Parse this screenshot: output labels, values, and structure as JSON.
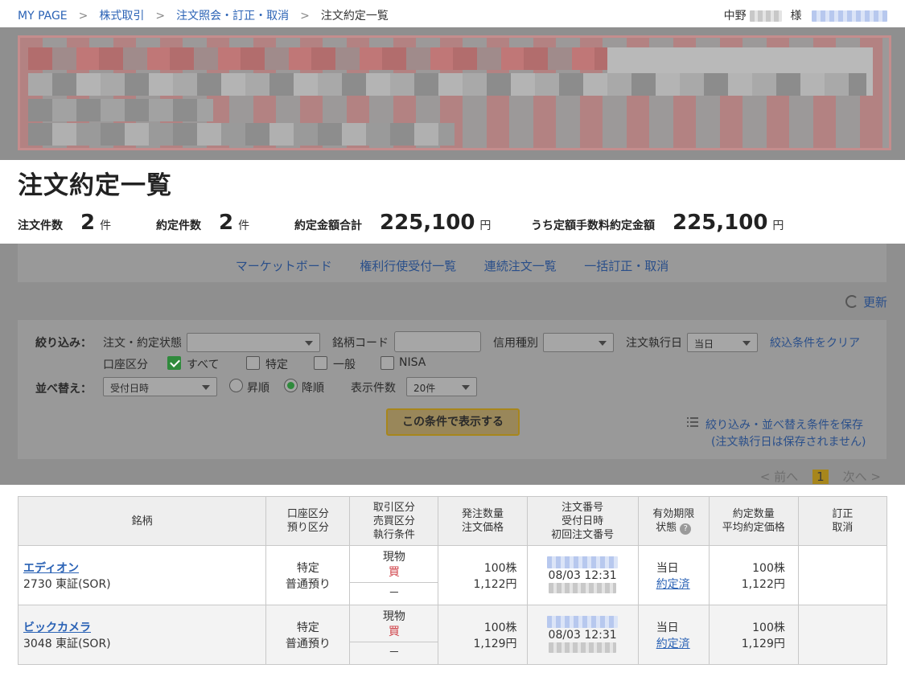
{
  "breadcrumb": {
    "items": [
      "MY PAGE",
      "株式取引",
      "注文照会・訂正・取消"
    ],
    "separator": ">",
    "current": "注文約定一覧"
  },
  "user": {
    "surname": "中野",
    "honorific": "様"
  },
  "page_title": "注文約定一覧",
  "summary": {
    "order_count_label": "注文件数",
    "order_count": "2",
    "order_count_unit": "件",
    "exec_count_label": "約定件数",
    "exec_count": "2",
    "exec_count_unit": "件",
    "exec_total_label": "約定金額合計",
    "exec_total": "225,100",
    "exec_total_unit": "円",
    "flat_fee_total_label": "うち定額手数料約定金額",
    "flat_fee_total": "225,100",
    "flat_fee_total_unit": "円"
  },
  "tabs": [
    "マーケットボード",
    "権利行使受付一覧",
    "連続注文一覧",
    "一括訂正・取消"
  ],
  "refresh_label": "更新",
  "filter": {
    "narrow_label": "絞り込み：",
    "status_label": "注文・約定状態",
    "code_label": "銘柄コード",
    "credit_label": "信用種別",
    "exec_date_label": "注文執行日",
    "exec_date_value": "当日",
    "clear_label": "絞込条件をクリア",
    "account_label": "口座区分",
    "account_options": [
      "すべて",
      "特定",
      "一般",
      "NISA"
    ],
    "account_checked": "すべて",
    "sort_label": "並べ替え：",
    "sort_value": "受付日時",
    "asc_label": "昇順",
    "desc_label": "降順",
    "sort_selected": "降順",
    "count_label": "表示件数",
    "count_value": "20件",
    "show_button": "この条件で表示する",
    "save_label": "絞り込み・並べ替え条件を保存",
    "save_note": "(注文執行日は保存されません)"
  },
  "pager": {
    "prev": "< 前へ",
    "current": "1",
    "next": "次へ >"
  },
  "table": {
    "headers": {
      "stock": "銘柄",
      "account": [
        "口座区分",
        "預り区分"
      ],
      "trade": [
        "取引区分",
        "売買区分",
        "執行条件"
      ],
      "order": [
        "発注数量",
        "注文価格"
      ],
      "order_no": [
        "注文番号",
        "受付日時",
        "初回注文番号"
      ],
      "validity": [
        "有効期限",
        "状態"
      ],
      "exec": [
        "約定数量",
        "平均約定価格"
      ],
      "modify": [
        "訂正",
        "取消"
      ]
    },
    "rows": [
      {
        "name": "エディオン",
        "code_market": "2730 東証(SOR)",
        "account": "特定",
        "custody": "普通預り",
        "trade_type": "現物",
        "side": "買",
        "condition": "－",
        "qty": "100株",
        "price": "1,122円",
        "received": "08/03 12:31",
        "validity": "当日",
        "status": "約定済",
        "exec_qty": "100株",
        "avg_price": "1,122円"
      },
      {
        "name": "ビックカメラ",
        "code_market": "3048 東証(SOR)",
        "account": "特定",
        "custody": "普通預り",
        "trade_type": "現物",
        "side": "買",
        "condition": "－",
        "qty": "100株",
        "price": "1,129円",
        "received": "08/03 12:31",
        "validity": "当日",
        "status": "約定済",
        "exec_qty": "100株",
        "avg_price": "1,129円"
      }
    ]
  },
  "colors": {
    "link": "#2a62b5",
    "buy": "#d0434a",
    "accent_gold": "#a7861c",
    "check_green": "#2f8a3c",
    "overlay_gray": "#8f8f8f"
  }
}
